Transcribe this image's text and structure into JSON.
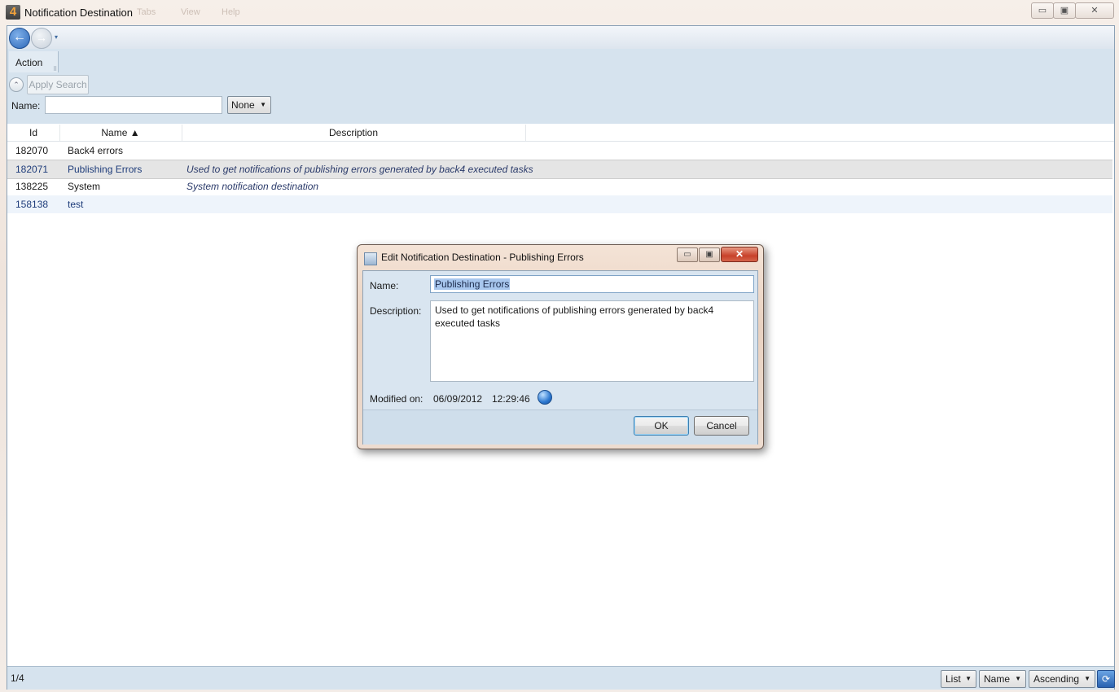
{
  "window": {
    "title": "Notification Destination",
    "icon_glyph": "4",
    "faded_menu": [
      "Tabs",
      "View",
      "Help"
    ],
    "controls": {
      "minimize": "▭",
      "maximize": "▣",
      "close": "✕"
    }
  },
  "nav": {
    "back": "←",
    "forward": "→",
    "dropdown": "▾"
  },
  "search": {
    "action_tab": "Action",
    "apply_search": "Apply Search",
    "name_label": "Name:",
    "name_value": "",
    "filter_value": "None"
  },
  "grid": {
    "columns": [
      "Id",
      "Name ▲",
      "Description"
    ],
    "rows": [
      {
        "id": "182070",
        "name": "Back4 errors",
        "description": ""
      },
      {
        "id": "182071",
        "name": "Publishing Errors",
        "description": "Used to get notifications of publishing errors generated by back4 executed tasks"
      },
      {
        "id": "138225",
        "name": "System",
        "description": "System notification destination"
      },
      {
        "id": "158138",
        "name": "test",
        "description": ""
      }
    ]
  },
  "status": {
    "page_count": "1/4",
    "view_mode": "List",
    "sort_field": "Name",
    "sort_order": "Ascending",
    "refresh": "⟳"
  },
  "dialog": {
    "title": "Edit Notification Destination - Publishing Errors",
    "name_label": "Name:",
    "name_value": "Publishing Errors",
    "description_label": "Description:",
    "description_value": "Used to get notifications of publishing errors generated by back4 executed tasks",
    "modified_label": "Modified on:",
    "modified_date": "06/09/2012",
    "modified_time": "12:29:46",
    "ok": "OK",
    "cancel": "Cancel",
    "close": "✕",
    "minimize": "▭",
    "maximize": "▣"
  }
}
